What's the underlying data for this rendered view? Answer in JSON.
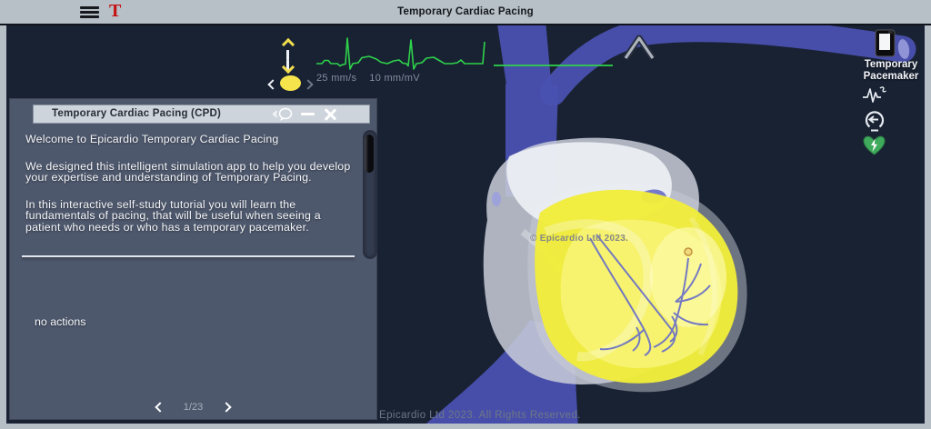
{
  "window": {
    "title": "Temporary Cardiac Pacing",
    "logo_letter": "T"
  },
  "ecg_strip": {
    "speed_label": "25 mm/s",
    "gain_label": "10 mm/mV"
  },
  "right_toolbar": {
    "pacemaker_label_line1": "Temporary",
    "pacemaker_label_line2": "Pacemaker"
  },
  "dialog": {
    "title": "Temporary Cardiac Pacing (CPD)",
    "paragraphs": [
      "Welcome to Epicardio Temporary Cardiac Pacing",
      "We designed this intelligent simulation app to help you develop your expertise and understanding of Temporary Pacing.",
      "In this interactive self-study tutorial you will learn the fundamentals of pacing, that will be useful when seeing a patient who needs or who has a temporary pacemaker."
    ],
    "actions_label": "no actions",
    "pagination": {
      "current": "1/23"
    }
  },
  "scene": {
    "watermark": "© Epicardio Ltd 2023."
  },
  "footer": {
    "copyright": "Epicardio Ltd 2023. All Rights Reserved."
  },
  "colors": {
    "frame": "#b7bfc7",
    "viewport_bg": "#192233",
    "panel_bg": "#4e586d",
    "titlebar_bg": "#cdd4dc",
    "ecg_green": "#2ed24b",
    "control_yellow": "#f6e44c",
    "vessel_blue": "#4a51b0",
    "ventricle_yellow": "#f1ec3b",
    "defib_green": "#3fa95c",
    "logo_red": "#c6100f"
  }
}
